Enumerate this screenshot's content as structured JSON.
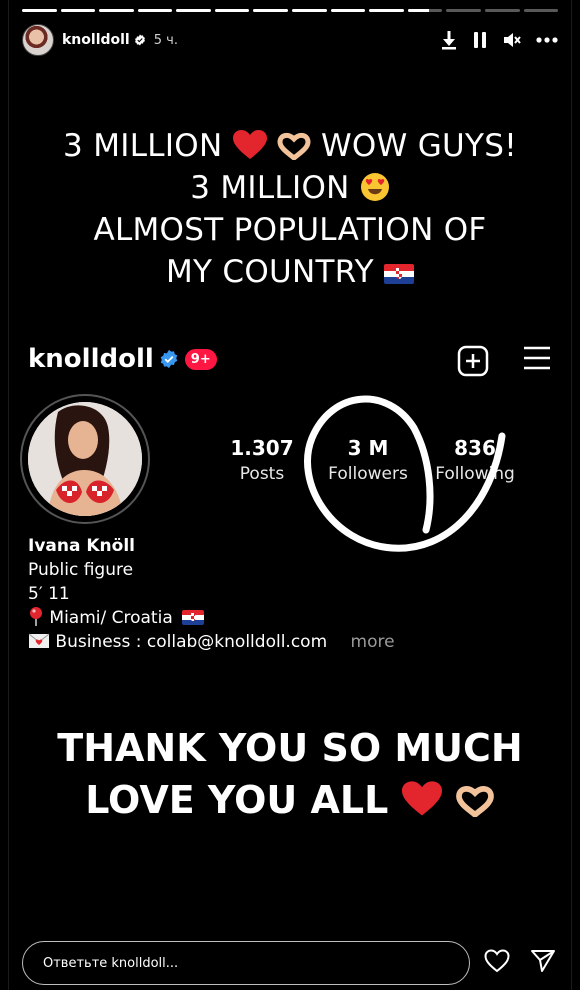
{
  "story": {
    "progress": [
      1,
      1,
      1,
      1,
      1,
      1,
      1,
      1,
      1,
      1,
      0.6,
      0,
      0,
      0
    ],
    "username": "knolldoll",
    "time_ago": "5 ч.",
    "controls": [
      "download-icon",
      "pause-icon",
      "mute-icon",
      "more-icon"
    ]
  },
  "headline": {
    "line1": "3 MILLION",
    "line1_end": "WOW GUYS!",
    "line2": "3 MILLION",
    "line3": "ALMOST POPULATION OF",
    "line4": "MY COUNTRY"
  },
  "profile": {
    "handle": "knolldoll",
    "notifications_badge": "9+",
    "posts_count": "1.307",
    "posts_label": "Posts",
    "followers_count": "3 M",
    "followers_label": "Followers",
    "following_count": "836",
    "following_label": "Following",
    "full_name": "Ivana Knöll",
    "category": "Public figure",
    "height": "5′ 11",
    "location": "Miami/ Croatia",
    "business": "Business : collab@knolldoll.com",
    "more": "more"
  },
  "thanks": {
    "line1": "THANK YOU SO MUCH",
    "line2": "LOVE YOU ALL"
  },
  "reply": {
    "placeholder": "Ответьте knolldoll..."
  },
  "colors": {
    "background": "#000000",
    "badge": "#ff1744",
    "verified": "#3897f0",
    "heart": "#e3252d"
  }
}
